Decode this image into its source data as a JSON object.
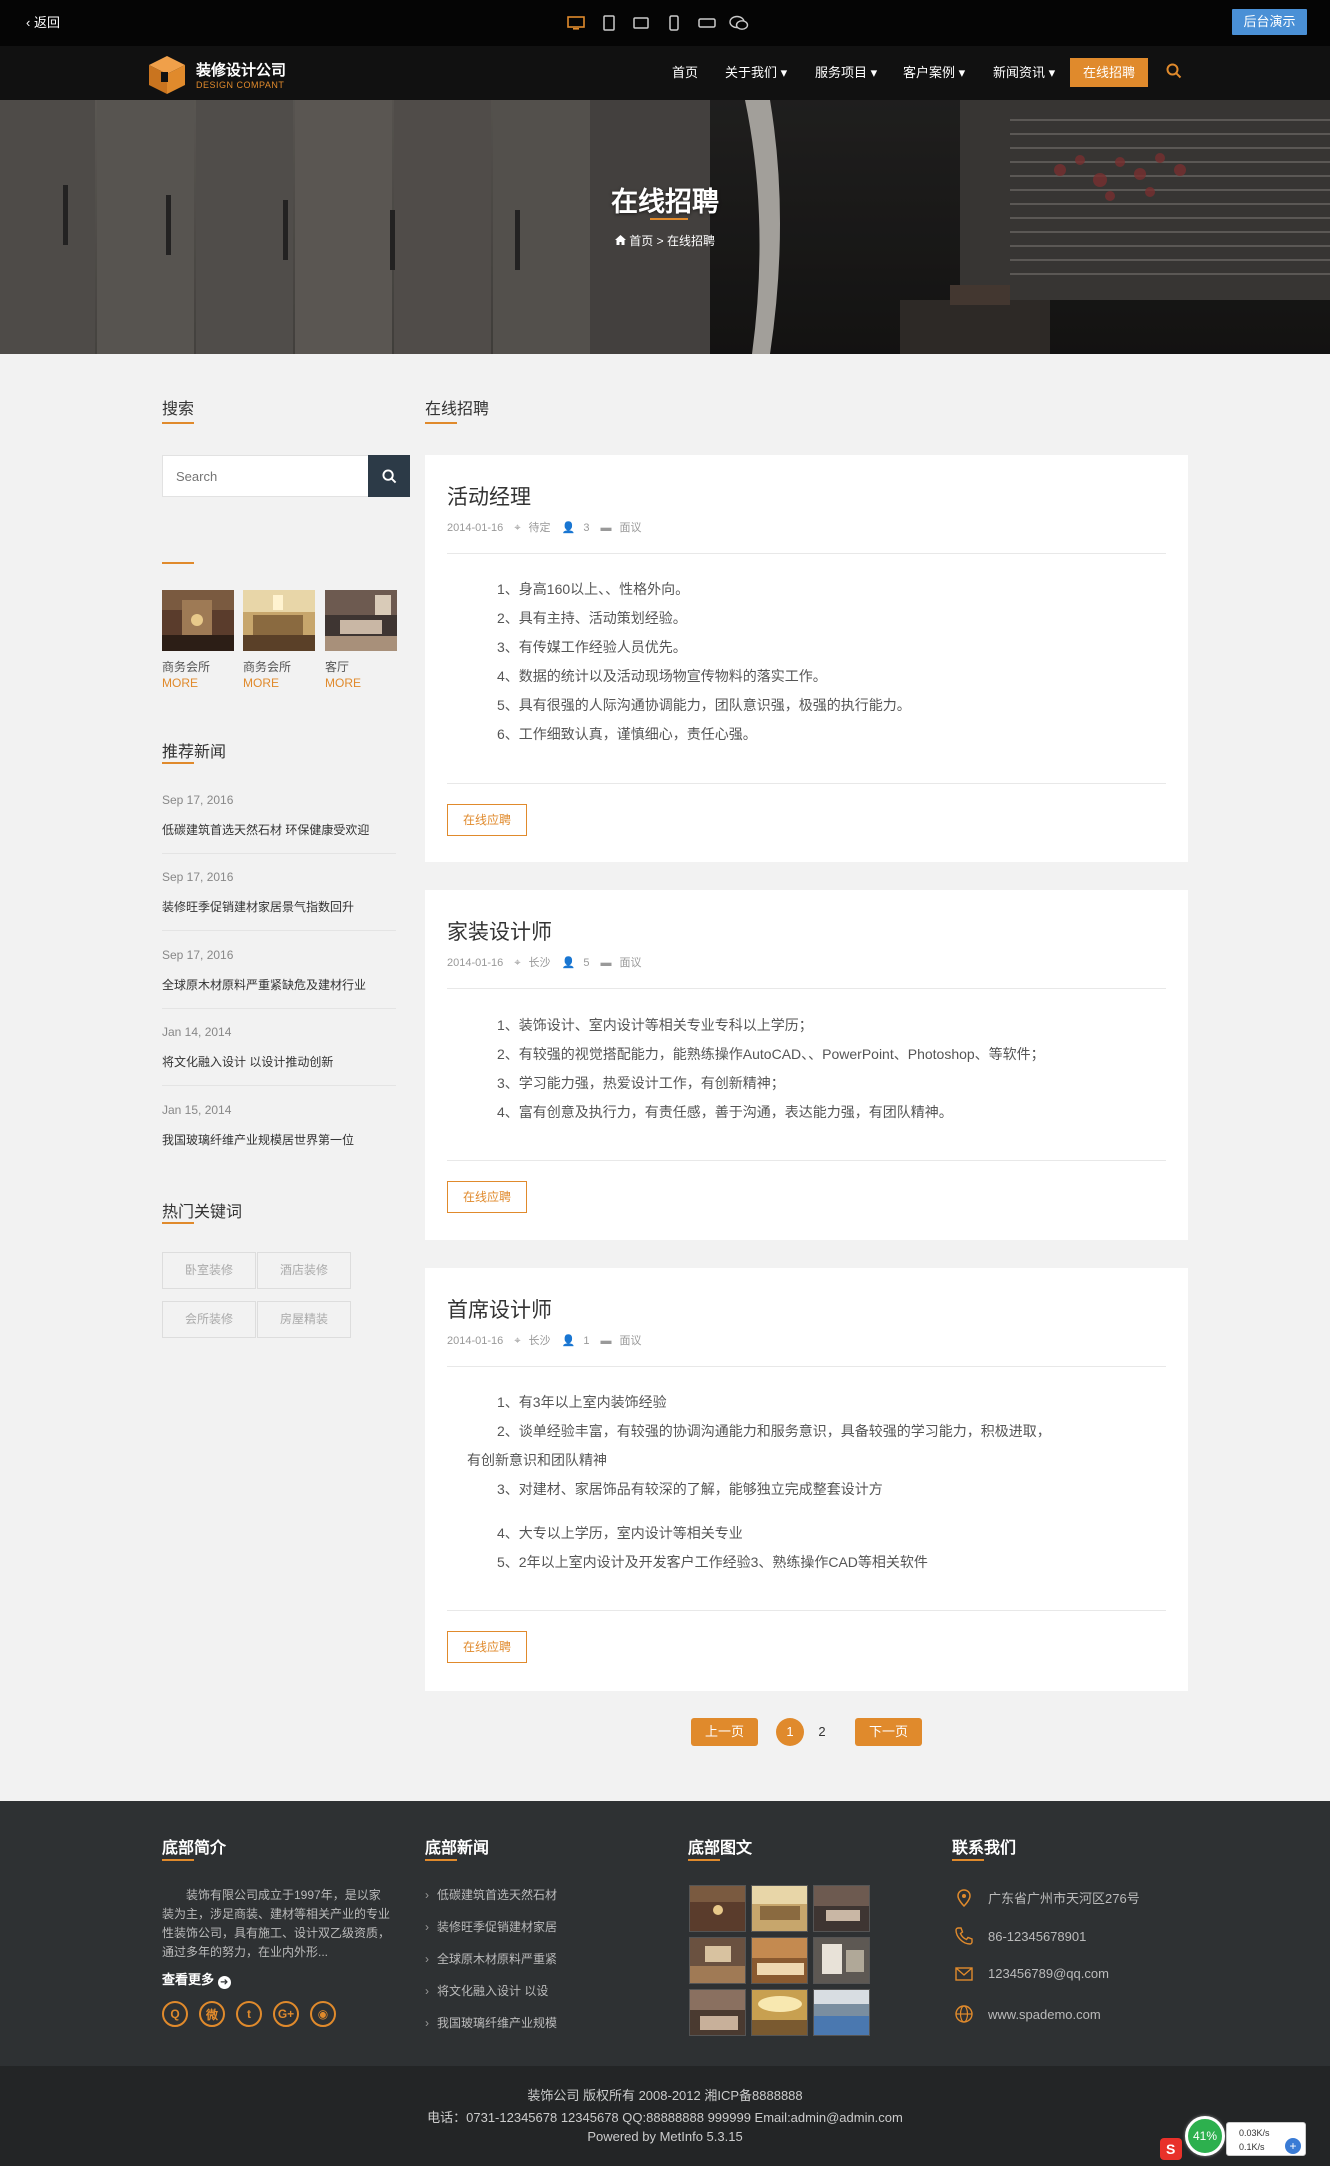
{
  "topbar": {
    "back_label": "返回",
    "device_icons": [
      "desktop-icon",
      "tablet-portrait-icon",
      "tablet-landscape-icon",
      "phone-portrait-icon",
      "phone-landscape-icon",
      "wechat-icon"
    ],
    "demo_button": "后台演示"
  },
  "header": {
    "brand": "装修设计公司",
    "brand_sub": "DESIGN COMPANT",
    "nav": [
      {
        "label": "首页"
      },
      {
        "label": "关于我们 ▾"
      },
      {
        "label": "服务项目 ▾"
      },
      {
        "label": "客户案例 ▾"
      },
      {
        "label": "新闻资讯 ▾"
      }
    ],
    "nav_active": "在线招聘"
  },
  "banner": {
    "title": "在线招聘",
    "breadcrumb_home": "首页",
    "breadcrumb_sep": ">",
    "breadcrumb_current": "在线招聘"
  },
  "sidebar": {
    "search_title": "搜索",
    "search_placeholder": "Search",
    "gallery": [
      {
        "caption": "商务会所",
        "more": "MORE"
      },
      {
        "caption": "商务会所",
        "more": "MORE"
      },
      {
        "caption": "客厅",
        "more": "MORE"
      }
    ],
    "news_title": "推荐新闻",
    "news": [
      {
        "date": "Sep 17, 2016",
        "title": "低碳建筑首选天然石材 环保健康受欢迎"
      },
      {
        "date": "Sep 17, 2016",
        "title": "装修旺季促销建材家居景气指数回升"
      },
      {
        "date": "Sep 17, 2016",
        "title": "全球原木材原料严重紧缺危及建材行业"
      },
      {
        "date": "Jan 14, 2014",
        "title": "将文化融入设计 以设计推动创新"
      },
      {
        "date": "Jan 15, 2014",
        "title": "我国玻璃纤维产业规模居世界第一位"
      }
    ],
    "tags_title": "热门关键词",
    "tags": [
      "卧室装修",
      "酒店装修",
      "会所装修",
      "房屋精装"
    ]
  },
  "main": {
    "section_title": "在线招聘",
    "apply_label": "在线应聘",
    "jobs": [
      {
        "title": "活动经理",
        "date": "2014-01-16",
        "location": "待定",
        "count": "3",
        "salary": "面议",
        "lines": [
          "1、身高160以上、、性格外向。",
          "2、具有主持、活动策划经验。",
          "3、有传媒工作经验人员优先。",
          "4、数据的统计以及活动现场物宣传物料的落实工作。",
          "5、具有很强的人际沟通协调能力，团队意识强，极强的执行能力。",
          "6、工作细致认真，谨慎细心，责任心强。"
        ]
      },
      {
        "title": "家装设计师",
        "date": "2014-01-16",
        "location": "长沙",
        "count": "5",
        "salary": "面议",
        "lines": [
          "1、装饰设计、室内设计等相关专业专科以上学历；",
          "2、有较强的视觉搭配能力，能熟练操作AutoCAD、、PowerPoint、Photoshop、等软件；",
          "3、学习能力强，热爱设计工作，有创新精神；",
          "4、富有创意及执行力，有责任感，善于沟通，表达能力强，有团队精神。"
        ]
      },
      {
        "title": "首席设计师",
        "date": "2014-01-16",
        "location": "长沙",
        "count": "1",
        "salary": "面议",
        "lines": [
          "1、有3年以上室内装饰经验",
          "2、谈单经验丰富，有较强的协调沟通能力和服务意识，具备较强的学习能力，积极进取，",
          "有创新意识和团队精神",
          "3、对建材、家居饰品有较深的了解，能够独立完成整套设计方",
          "4、大专以上学历，室内设计等相关专业",
          "5、2年以上室内设计及开发客户工作经验3、熟练操作CAD等相关软件"
        ]
      }
    ],
    "pagination": {
      "prev": "上一页",
      "pages": [
        "1",
        "2"
      ],
      "next": "下一页"
    }
  },
  "footer": {
    "intro_title": "底部简介",
    "intro_text": "装饰有限公司成立于1997年，是以家装为主，涉足商装、建材等相关产业的专业性装饰公司，具有施工、设计双乙级资质，通过多年的努力，在业内外形...",
    "more_label": "查看更多",
    "social": [
      "qq-icon",
      "weibo-icon",
      "twitter-icon",
      "googleplus-icon",
      "wechat-icon"
    ],
    "news_title": "底部新闻",
    "news": [
      "低碳建筑首选天然石材",
      "装修旺季促销建材家居",
      "全球原木材原料严重紧",
      "将文化融入设计 以设",
      "我国玻璃纤维产业规模"
    ],
    "gallery_title": "底部图文",
    "contact_title": "联系我们",
    "contact": [
      {
        "icon": "location-icon",
        "text": "广东省广州市天河区276号"
      },
      {
        "icon": "phone-icon",
        "text": "86-12345678901"
      },
      {
        "icon": "mail-icon",
        "text": "123456789@qq.com"
      },
      {
        "icon": "globe-icon",
        "text": "www.spademo.com"
      }
    ]
  },
  "copyright": {
    "line1": "装饰公司 版权所有 2008-2012 湘ICP备8888888",
    "line2": "电话：0731-12345678 12345678 QQ:88888888 999999 Email:admin@admin.com",
    "line3": "Powered by MetInfo 5.3.15"
  },
  "net_widget": {
    "percent": "41%",
    "up": "0.03K/s",
    "down": "0.1K/s"
  },
  "colors": {
    "accent": "#e08a2c",
    "header_bg": "#111111",
    "footer_bg": "#2e3133",
    "demo_button": "#4a90d6"
  }
}
